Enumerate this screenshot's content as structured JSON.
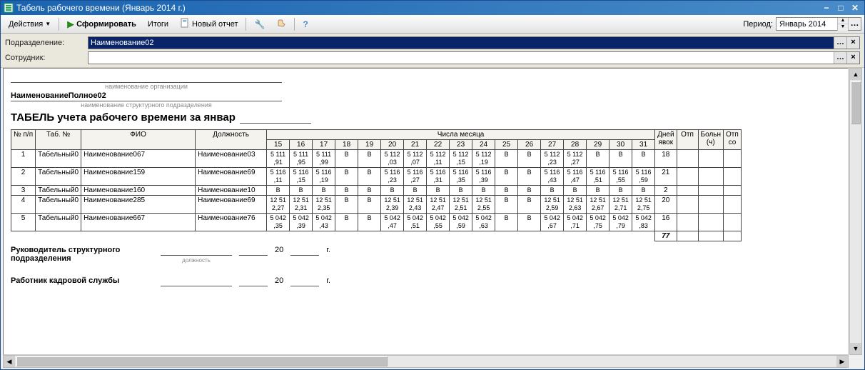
{
  "window": {
    "title": "Табель рабочего времени (Январь 2014 г.)"
  },
  "toolbar": {
    "actions": "Действия",
    "form": "Сформировать",
    "totals": "Итоги",
    "new_report": "Новый отчет",
    "period_label": "Период:",
    "period_value": "Январь 2014"
  },
  "filters": {
    "dept_label": "Подразделение:",
    "dept_value": "Наименование02",
    "emp_label": "Сотрудник:",
    "emp_value": ""
  },
  "report": {
    "org_hint": "наименование организации",
    "dept_full": "НаименованиеПолное02",
    "dept_hint": "наименование структурного подразделения",
    "title_prefix": "ТАБЕЛЬ учета рабочего времени за январ",
    "pos_hint": "должность"
  },
  "table": {
    "headers": {
      "no": "№ п/п",
      "tab": "Таб. №",
      "fio": "ФИО",
      "post": "Должность",
      "days_header": "Числа месяца",
      "days_worked": "Дней явок",
      "otp": "Отп",
      "boln": "Больн (ч)",
      "otp_so": "Отп со"
    },
    "day_cols": [
      "15",
      "16",
      "17",
      "18",
      "19",
      "20",
      "21",
      "22",
      "23",
      "24",
      "25",
      "26",
      "27",
      "28",
      "29",
      "30",
      "31"
    ],
    "rows": [
      {
        "no": "1",
        "tab": "Табельный0",
        "fio": "Наименование067",
        "post": "Наименование03",
        "cells": [
          "5 111 ,91",
          "5 111 ,95",
          "5 111 ,99",
          "В",
          "В",
          "5 112 ,03",
          "5 112 ,07",
          "5 112 ,11",
          "5 112 ,15",
          "5 112 ,19",
          "В",
          "В",
          "5 112 ,23",
          "5 112 ,27",
          "В",
          "В",
          "В"
        ],
        "days": "18"
      },
      {
        "no": "2",
        "tab": "Табельный0",
        "fio": "Наименование159",
        "post": "Наименование69",
        "cells": [
          "5 116 ,11",
          "5 116 ,15",
          "5 116 ,19",
          "В",
          "В",
          "5 116 ,23",
          "5 116 ,27",
          "5 116 ,31",
          "5 116 ,35",
          "5 116 ,39",
          "В",
          "В",
          "5 116 ,43",
          "5 116 ,47",
          "5 116 ,51",
          "5 116 ,55",
          "5 116 ,59"
        ],
        "days": "21"
      },
      {
        "no": "3",
        "tab": "Табельный0",
        "fio": "Наименование160",
        "post": "Наименование10",
        "cells": [
          "В",
          "В",
          "В",
          "В",
          "В",
          "В",
          "В",
          "В",
          "В",
          "В",
          "В",
          "В",
          "В",
          "В",
          "В",
          "В",
          "В"
        ],
        "days": "2"
      },
      {
        "no": "4",
        "tab": "Табельный0",
        "fio": "Наименование285",
        "post": "Наименование69",
        "cells": [
          "12 51 2,27",
          "12 51 2,31",
          "12 51 2,35",
          "В",
          "В",
          "12 51 2,39",
          "12 51 2,43",
          "12 51 2,47",
          "12 51 2,51",
          "12 51 2,55",
          "В",
          "В",
          "12 51 2,59",
          "12 51 2,63",
          "12 51 2,67",
          "12 51 2,71",
          "12 51 2,75"
        ],
        "days": "20"
      },
      {
        "no": "5",
        "tab": "Табельный0",
        "fio": "Наименование667",
        "post": "Наименование76",
        "cells": [
          "5 042 ,35",
          "5 042 ,39",
          "5 042 ,43",
          "В",
          "В",
          "5 042 ,47",
          "5 042 ,51",
          "5 042 ,55",
          "5 042 ,59",
          "5 042 ,63",
          "В",
          "В",
          "5 042 ,67",
          "5 042 ,71",
          "5 042 ,75",
          "5 042 ,79",
          "5 042 ,83"
        ],
        "days": "16"
      }
    ],
    "total_days": "77"
  },
  "signatures": {
    "head": "Руководитель структурного подразделения",
    "hr": "Работник кадровой службы",
    "year": "20",
    "year_suffix": "г."
  }
}
